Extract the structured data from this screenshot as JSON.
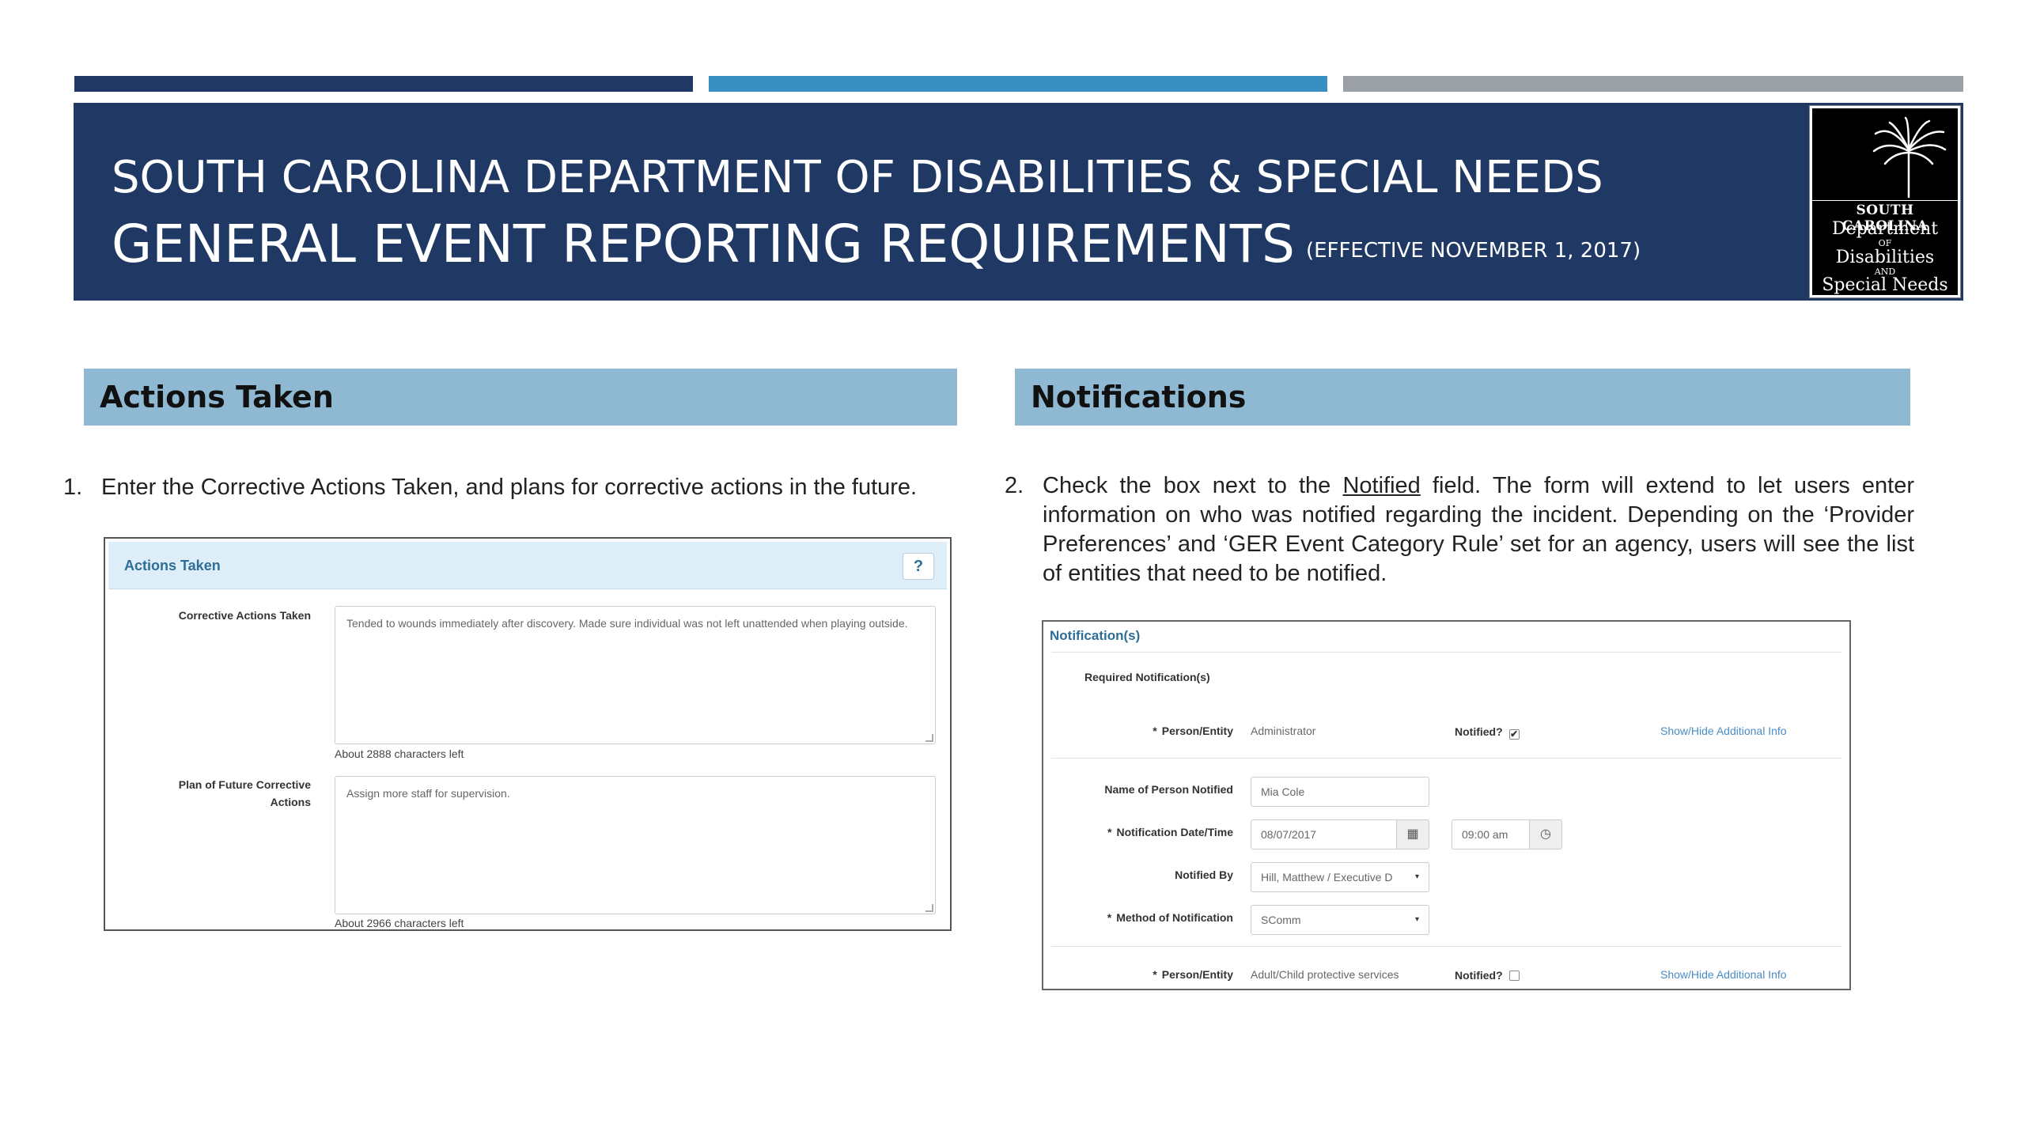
{
  "header": {
    "line1": "SOUTH CAROLINA DEPARTMENT OF DISABILITIES & SPECIAL NEEDS",
    "line2": "GENERAL EVENT REPORTING REQUIREMENTS",
    "effective": "(EFFECTIVE NOVEMBER 1, 2017)",
    "colors": {
      "navy": "#1f3864",
      "blue": "#3a8fc2",
      "gray": "#9aa0a6",
      "section": "#8fb9d3"
    }
  },
  "logo": {
    "icon": "palmetto-moon-icon",
    "line1": "SOUTH CAROLINA",
    "line2": "Department",
    "line3": "OF",
    "line4": "Disabilities",
    "line5": "AND",
    "line6": "Special Needs"
  },
  "sections": {
    "left_title": "Actions Taken",
    "right_title": "Notifications"
  },
  "steps": {
    "s1_num": "1.",
    "s1_text": "Enter the Corrective Actions Taken, and plans for corrective actions in the future.",
    "s2_num": "2.",
    "s2_pre": "Check the box next to the",
    "s2_link": "Notified",
    "s2_post": "field. The form will extend to let users enter information on who was notified regarding the incident. Depending on the ‘Provider Preferences’ and ‘GER Event Category Rule’ set for an agency, users will see the list of entities that need to be notified."
  },
  "actions_panel": {
    "title": "Actions Taken",
    "help": "?",
    "corrective_label": "Corrective Actions Taken",
    "corrective_value": "Tended to wounds immediately after discovery. Made sure individual was not left unattended when playing outside.",
    "corrective_hint": "About 2888 characters left",
    "plan_label": "Plan of Future Corrective Actions",
    "plan_value": "Assign more staff for supervision.",
    "plan_hint": "About 2966 characters left"
  },
  "notifications_panel": {
    "title": "Notification(s)",
    "required_label": "Required Notification(s)",
    "required_mark": "*",
    "person_label": "Person/Entity",
    "person1_value": "Administrator",
    "notified_label": "Notified?",
    "checkmark": "✔",
    "show_hide": "Show/Hide Additional Info",
    "name_label": "Name of Person Notified",
    "name_value": "Mia Cole",
    "date_label": "Notification Date/Time",
    "date_value": "08/07/2017",
    "calendar_icon": "▦",
    "time_value": "09:00 am",
    "clock_icon": "◷",
    "notified_by_label": "Notified By",
    "notified_by_value": "Hill, Matthew / Executive D",
    "method_label": "Method of Notification",
    "method_value": "SComm",
    "caret": "▾",
    "person2_value": "Adult/Child protective services"
  }
}
